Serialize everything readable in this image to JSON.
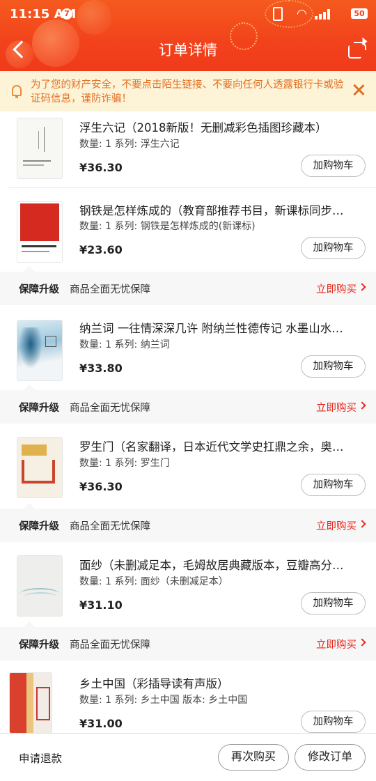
{
  "status_bar": {
    "time": "11:15 AM",
    "notification_count": "7",
    "battery": "50"
  },
  "nav": {
    "title": "订单详情"
  },
  "warning": {
    "text": "为了您的财产安全，不要点击陌生链接、不要向任何人透露银行卡或验证码信息，谨防诈骗！"
  },
  "products": [
    {
      "title": "浮生六记（2018新版！无删减彩色插图珍藏本）",
      "meta": "数量: 1 系列: 浮生六记",
      "price": "¥36.30",
      "cart_label": "加购物车",
      "cover_icon": "book-cover-fusheng-liuji"
    },
    {
      "title": "钢铁是怎样炼成的（教育部推荐书目，新课标同步…",
      "meta": "数量: 1 系列: 钢铁是怎样炼成的(新课标)",
      "price": "¥23.60",
      "cart_label": "加购物车",
      "cover_icon": "book-cover-gangtie"
    },
    {
      "title": "纳兰词 一往情深深几许 附纳兰性德传记 水墨山水…",
      "meta": "数量: 1 系列: 纳兰词",
      "price": "¥33.80",
      "cart_label": "加购物车",
      "cover_icon": "book-cover-nalan-ci"
    },
    {
      "title": "罗生门（名家翻译，日本近代文学史扛鼎之余，奥…",
      "meta": "数量: 1 系列: 罗生门",
      "price": "¥36.30",
      "cart_label": "加购物车",
      "cover_icon": "book-cover-luoshengmen"
    },
    {
      "title": "面纱（未删减足本，毛姆故居典藏版本，豆瓣高分…",
      "meta": "数量: 1 系列: 面纱（未删减足本）",
      "price": "¥31.10",
      "cart_label": "加购物车",
      "cover_icon": "book-cover-miansha"
    },
    {
      "title": "乡土中国（彩插导读有声版）",
      "meta": "数量: 1 系列: 乡土中国 版本: 乡土中国",
      "price": "¥31.00",
      "cart_label": "加购物车",
      "cover_icon": "book-cover-xiangtu-zhongguo"
    }
  ],
  "guarantee": {
    "label": "保障升级",
    "desc": "商品全面无忧保障",
    "buy": "立即购买"
  },
  "bottom_bar": {
    "refund": "申请退款",
    "rebuy": "再次购买",
    "modify": "修改订单"
  },
  "colors": {
    "header": "#f2421c",
    "warning_bg": "#fdf4d8",
    "warning_text": "#e36f24",
    "accent_red": "#e8281c"
  }
}
